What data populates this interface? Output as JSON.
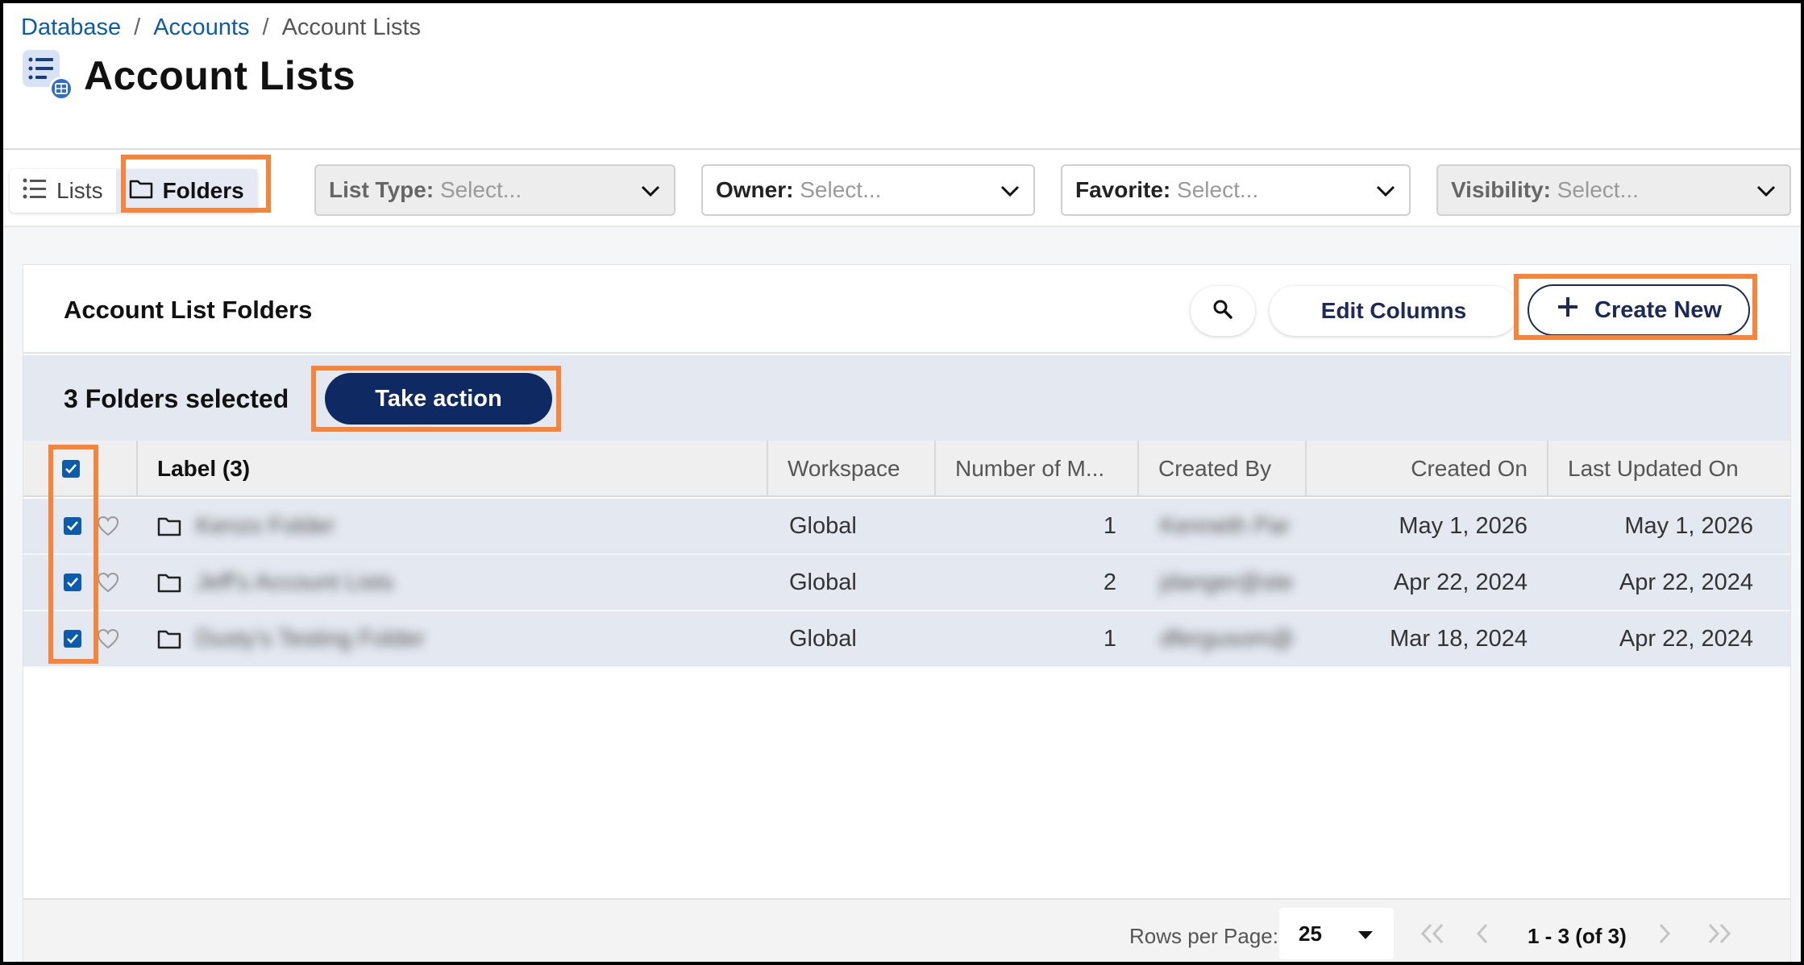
{
  "breadcrumb": {
    "items": [
      "Database",
      "Accounts"
    ],
    "separator": "/",
    "current": "Account Lists"
  },
  "page": {
    "title": "Account Lists"
  },
  "view_toggle": {
    "lists_label": "Lists",
    "folders_label": "Folders",
    "active": "Folders"
  },
  "filters": [
    {
      "key": "List Type:",
      "value": "Select...",
      "disabled": true
    },
    {
      "key": "Owner:",
      "value": "Select...",
      "disabled": false
    },
    {
      "key": "Favorite:",
      "value": "Select...",
      "disabled": false
    },
    {
      "key": "Visibility:",
      "value": "Select...",
      "disabled": true
    }
  ],
  "card": {
    "title": "Account List Folders",
    "edit_columns_label": "Edit Columns",
    "create_new_label": "Create New"
  },
  "selection": {
    "text": "3 Folders selected",
    "take_action_label": "Take action"
  },
  "table": {
    "columns": [
      "Label (3)",
      "Workspace",
      "Number of M...",
      "Created By",
      "Created On",
      "Last Updated On"
    ],
    "rows": [
      {
        "label": "Kenzo Folder",
        "workspace": "Global",
        "number": "1",
        "created_by": "Kenneth Par",
        "created_on": "May 1, 2026",
        "updated_on": "May 1, 2026"
      },
      {
        "label": "Jeff's Account Lists",
        "workspace": "Global",
        "number": "2",
        "created_by": "jdanger@ste",
        "created_on": "Apr 22, 2024",
        "updated_on": "Apr 22, 2024"
      },
      {
        "label": "Dusty's Testing Folder",
        "workspace": "Global",
        "number": "1",
        "created_by": "dfergusom@",
        "created_on": "Mar 18, 2024",
        "updated_on": "Apr 22, 2024"
      }
    ]
  },
  "pagination": {
    "rows_per_page_label": "Rows per Page:",
    "rows_per_page_value": "25",
    "range_text": "1 - 3 (of 3)"
  },
  "colors": {
    "accent": "#0f2a63",
    "link": "#0b5cad",
    "highlight": "#f6843b",
    "selected_row": "#e3e8f1"
  }
}
